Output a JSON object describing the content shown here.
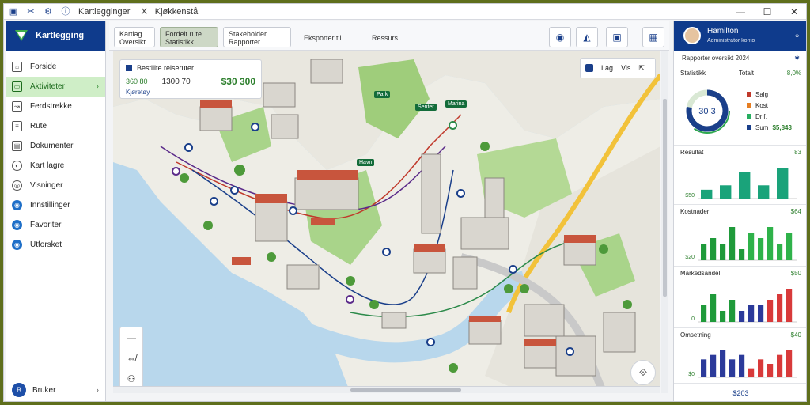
{
  "window": {
    "title": "Kartlegginger",
    "tab_close": "X",
    "tab_title": "Kjøkkenstå",
    "controls": {
      "minimize": "—",
      "maximize": "☐",
      "close": "✕"
    }
  },
  "sidebar": {
    "brand": "Kartlegging",
    "items": [
      {
        "label": "Forside",
        "icon": "home-icon",
        "glyph": "⌂"
      },
      {
        "label": "Aktiviteter",
        "icon": "activity-icon",
        "glyph": "▭",
        "active": true
      },
      {
        "label": "Ferdstrekke",
        "icon": "route-icon",
        "glyph": "↝"
      },
      {
        "label": "Rute",
        "icon": "list-icon",
        "glyph": "≡"
      },
      {
        "label": "Dokumenter",
        "icon": "document-icon",
        "glyph": "▤"
      },
      {
        "label": "Kart lagre",
        "icon": "globe-icon",
        "glyph": "◐"
      },
      {
        "label": "Visninger",
        "icon": "eye-icon",
        "glyph": "◎"
      },
      {
        "label": "Innstillinger",
        "icon": "settings-icon",
        "glyph": "◉"
      },
      {
        "label": "Favoriter",
        "icon": "star-icon",
        "glyph": "◉"
      },
      {
        "label": "Utforsket",
        "icon": "explore-icon",
        "glyph": "◉"
      }
    ],
    "footer_label": "Bruker",
    "footer_initial": "B"
  },
  "toolbar": {
    "tabs": [
      {
        "label": "Kartlag",
        "sub": "Oversikt"
      },
      {
        "label": "Fordelt rute",
        "sub": "Statistikk",
        "active": true
      },
      {
        "label": "Stakeholder",
        "sub": "Rapporter"
      },
      {
        "label": "Eksporter til"
      },
      {
        "label": "Ressurs"
      }
    ],
    "buttons": [
      {
        "name": "layers-button",
        "glyph": "◉"
      },
      {
        "name": "share-button",
        "glyph": "◭"
      },
      {
        "name": "save-button",
        "glyph": "▣"
      },
      {
        "name": "export-button",
        "glyph": "▦"
      }
    ]
  },
  "map": {
    "card": {
      "title": "Bestillte reiseruter",
      "val1": "360 80",
      "val2": "1300 70",
      "big": "$30 300",
      "sub": "Kjøretøy"
    },
    "controls": {
      "label1": "Lag",
      "label2": "Vis",
      "compass": "⇱"
    },
    "labels": [
      "Park",
      "Senter",
      "Marina",
      "Havn"
    ],
    "zoom": {
      "in": "—",
      "mid": "⇎",
      "out": "⚇"
    },
    "compass_glyph": "⟐"
  },
  "panel": {
    "user_name": "Hamilton",
    "user_role": "Administrator konto",
    "subtitle": "Rapporter oversikt 2024",
    "donut": {
      "title": "Statistikk",
      "title_right": "Totalt",
      "title_value": "8,0%",
      "center": "30 3",
      "value": 0.78,
      "legend": [
        {
          "label": "Salg",
          "color": "#c0392b"
        },
        {
          "label": "Kost",
          "color": "#e67e22"
        },
        {
          "label": "Drift",
          "color": "#27ae60"
        },
        {
          "label": "Sum",
          "color": "#1a3f8a",
          "value": "$5,843"
        }
      ]
    },
    "charts": [
      {
        "title": "Resultat",
        "value": "83",
        "tick": "$50",
        "values": [
          2,
          3,
          6,
          3,
          7
        ]
      },
      {
        "title": "Kostnader",
        "value": "$64",
        "tick": "$20",
        "values": [
          3,
          4,
          3,
          6,
          2,
          5,
          4,
          6,
          3,
          5
        ]
      },
      {
        "title": "Markedsandel",
        "value": "$50",
        "tick": "0",
        "values": [
          3,
          5,
          2,
          4,
          2,
          3,
          3,
          4,
          5,
          6
        ]
      },
      {
        "title": "Omsetning",
        "value": "$40",
        "tick": "$0",
        "values": [
          4,
          5,
          6,
          4,
          5,
          2,
          4,
          3,
          5,
          6
        ]
      }
    ],
    "footer": "$203"
  }
}
